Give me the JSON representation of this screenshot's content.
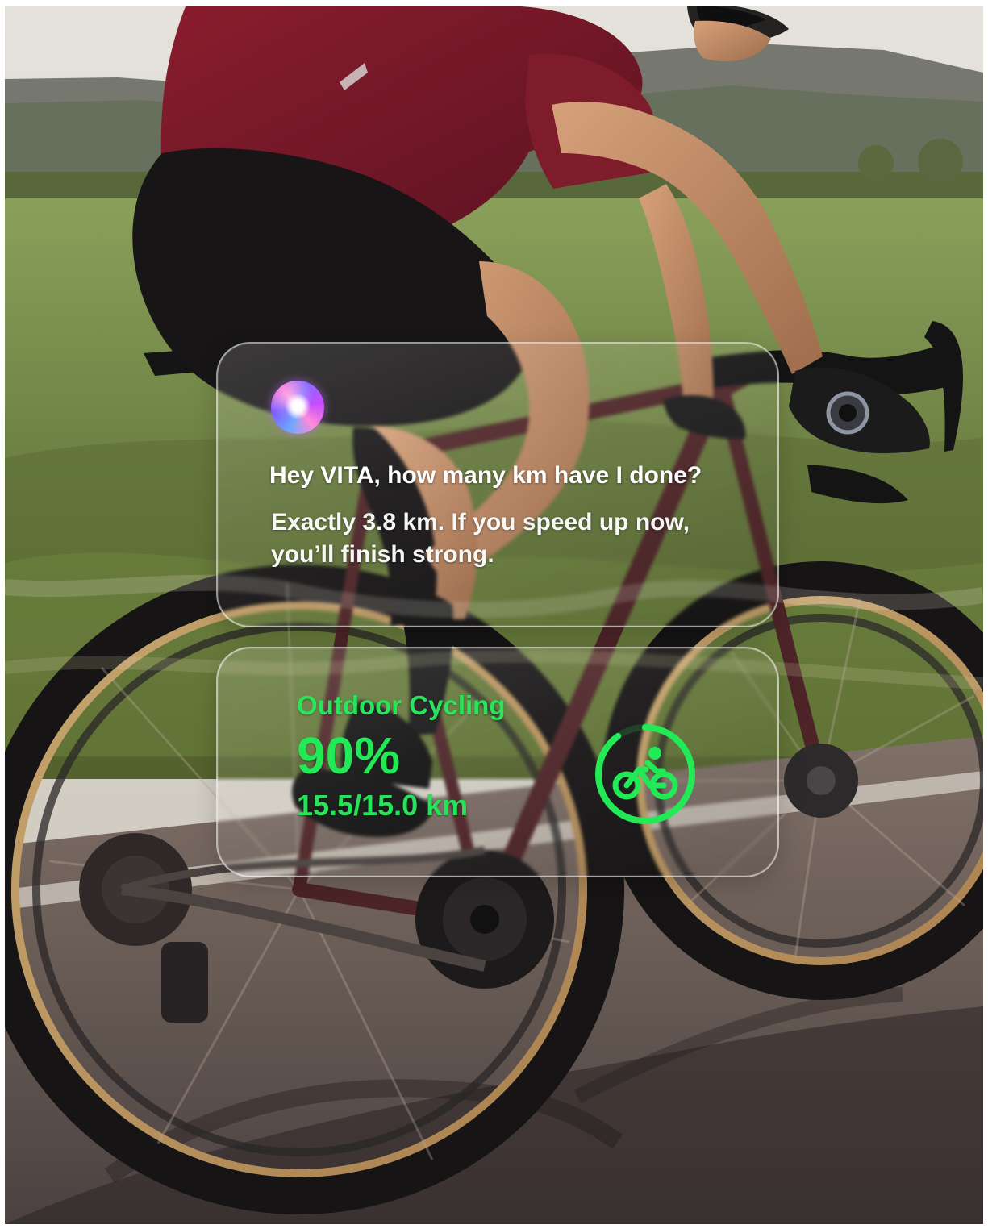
{
  "assistant": {
    "question": "Hey VITA, how many km have I done?",
    "answer": "Exactly 3.8 km. If you speed up now, you’ll finish strong."
  },
  "workout": {
    "title": "Outdoor Cycling",
    "percent_label": "90%",
    "distance_label": "15.5/15.0 km",
    "progress_fraction": 0.9,
    "icon": "bicycle-icon"
  },
  "colors": {
    "accent_green": "#22ea56",
    "text_white": "#ffffff"
  }
}
